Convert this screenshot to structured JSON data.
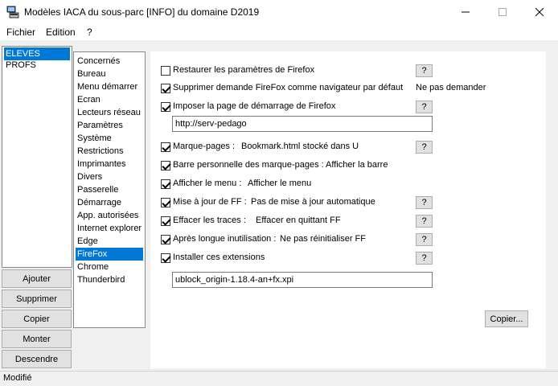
{
  "window": {
    "title": "Modèles IACA du sous-parc [INFO] du domaine D2019",
    "minimize": "—",
    "maximize": "☐",
    "close": "✕"
  },
  "menu": [
    "Fichier",
    "Edition",
    "?"
  ],
  "groups": [
    {
      "label": "ELEVES",
      "selected": true
    },
    {
      "label": "PROFS",
      "selected": false
    }
  ],
  "buttons": {
    "add": "Ajouter",
    "delete": "Supprimer",
    "copy": "Copier",
    "up": "Monter",
    "down": "Descendre",
    "copy_dots": "Copier..."
  },
  "categories": [
    {
      "label": "Concernés",
      "selected": false
    },
    {
      "label": "Bureau",
      "selected": false
    },
    {
      "label": "Menu démarrer",
      "selected": false
    },
    {
      "label": "Ecran",
      "selected": false
    },
    {
      "label": "Lecteurs réseau",
      "selected": false
    },
    {
      "label": "Paramètres",
      "selected": false
    },
    {
      "label": "Système",
      "selected": false
    },
    {
      "label": "Restrictions",
      "selected": false
    },
    {
      "label": "Imprimantes",
      "selected": false
    },
    {
      "label": "Divers",
      "selected": false
    },
    {
      "label": "Passerelle",
      "selected": false
    },
    {
      "label": "Démarrage",
      "selected": false
    },
    {
      "label": "App. autorisées",
      "selected": false
    },
    {
      "label": "Internet explorer",
      "selected": false
    },
    {
      "label": "Edge",
      "selected": false
    },
    {
      "label": "FireFox",
      "selected": true
    },
    {
      "label": "Chrome",
      "selected": false
    },
    {
      "label": "Thunderbird",
      "selected": false
    }
  ],
  "options": [
    {
      "label": "Restaurer les paramètres de Firefox",
      "checked": false,
      "value": "",
      "help": "?"
    },
    {
      "label": "Supprimer demande FireFox comme navigateur par défaut",
      "checked": true,
      "value": "Ne pas demander",
      "help": ""
    },
    {
      "label": "Imposer la page de démarrage de Firefox",
      "checked": true,
      "value": "",
      "help": "?"
    },
    {
      "label": "Marque-pages :",
      "checked": true,
      "value": "Bookmark.html stocké dans U",
      "help": "?"
    },
    {
      "label": "Barre personnelle des marque-pages :",
      "checked": true,
      "value": "Afficher la barre",
      "help": ""
    },
    {
      "label": "Afficher le menu :",
      "checked": true,
      "value": "Afficher le menu",
      "help": ""
    },
    {
      "label": "Mise à jour de FF :",
      "checked": true,
      "value": "Pas de mise à jour automatique",
      "help": "?"
    },
    {
      "label": "Effacer les traces :",
      "checked": true,
      "value": "Effacer en quittant FF",
      "help": "?"
    },
    {
      "label": "Après longue inutilisation :",
      "checked": true,
      "value": "Ne pas réinitialiser FF",
      "help": "?"
    },
    {
      "label": "Installer ces extensions",
      "checked": true,
      "value": "",
      "help": "?"
    }
  ],
  "fields": {
    "homepage": "http://serv-pedago",
    "extensions": "ublock_origin-1.18.4-an+fx.xpi"
  },
  "status": "Modifié"
}
